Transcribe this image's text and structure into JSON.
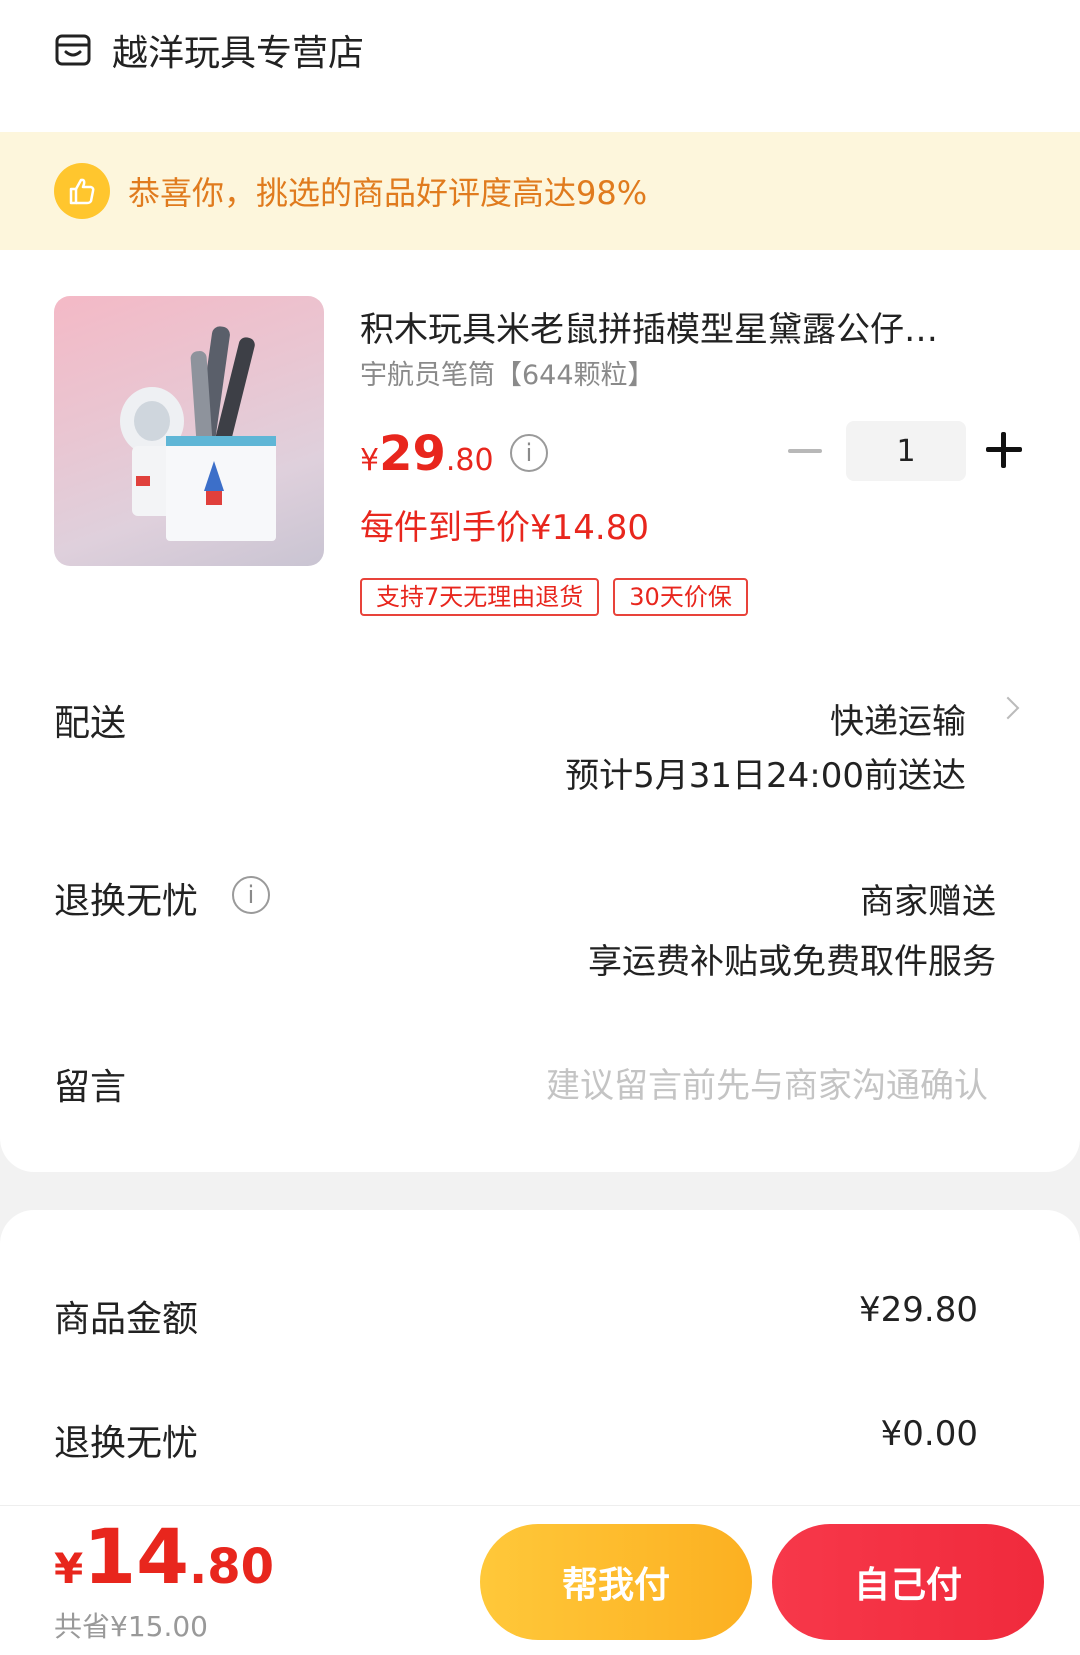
{
  "store": {
    "name": "越洋玩具专营店",
    "icon": "store-icon"
  },
  "banner": {
    "text": "恭喜你，挑选的商品好评度高达98%",
    "icon": "thumbs-up-icon"
  },
  "product": {
    "title": "积木玩具米老鼠拼插模型星黛露公仔…",
    "spec": "宇航员笔筒【644颗粒】",
    "price_symbol": "¥",
    "price_int": "29",
    "price_dec": ".80",
    "quantity": "1",
    "unit_price_text": "每件到手价¥14.80",
    "tags": [
      "支持7天无理由退货",
      "30天价保"
    ]
  },
  "delivery": {
    "label": "配送",
    "method": "快递运输",
    "eta": "预计5月31日24:00前送达"
  },
  "return_service": {
    "label": "退换无忧",
    "value": "商家赠送",
    "desc": "享运费补贴或免费取件服务"
  },
  "message": {
    "label": "留言",
    "placeholder": "建议留言前先与商家沟通确认"
  },
  "summary": {
    "goods_label": "商品金额",
    "goods_value": "¥29.80",
    "return_label": "退换无忧",
    "return_value": "¥0.00"
  },
  "footer": {
    "total_symbol": "¥",
    "total_int": "14",
    "total_dec": ".80",
    "saved": "共省¥15.00",
    "help_pay": "帮我付",
    "self_pay": "自己付"
  },
  "colors": {
    "accent_red": "#e8261d",
    "banner_bg": "#fdf6dc",
    "help_btn": "#fcb021",
    "self_btn": "#f02a3c"
  }
}
